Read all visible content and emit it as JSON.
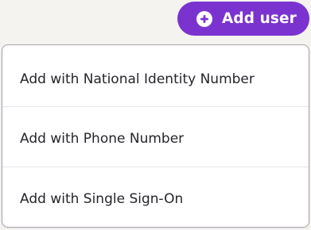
{
  "header": {
    "add_user_button": {
      "label": "Add user",
      "icon": "plus-circle-icon",
      "background_color": "#7b33cf",
      "text_color": "#ffffff"
    }
  },
  "dropdown": {
    "items": [
      {
        "label": "Add with National Identity Number"
      },
      {
        "label": "Add with Phone Number"
      },
      {
        "label": "Add with Single Sign-On"
      }
    ],
    "border_color": "#a6a0ae",
    "divider_color": "#e5e2ea"
  },
  "colors": {
    "page_background": "#f4f3f0",
    "menu_text": "#26242b",
    "accent": "#7b33cf"
  }
}
